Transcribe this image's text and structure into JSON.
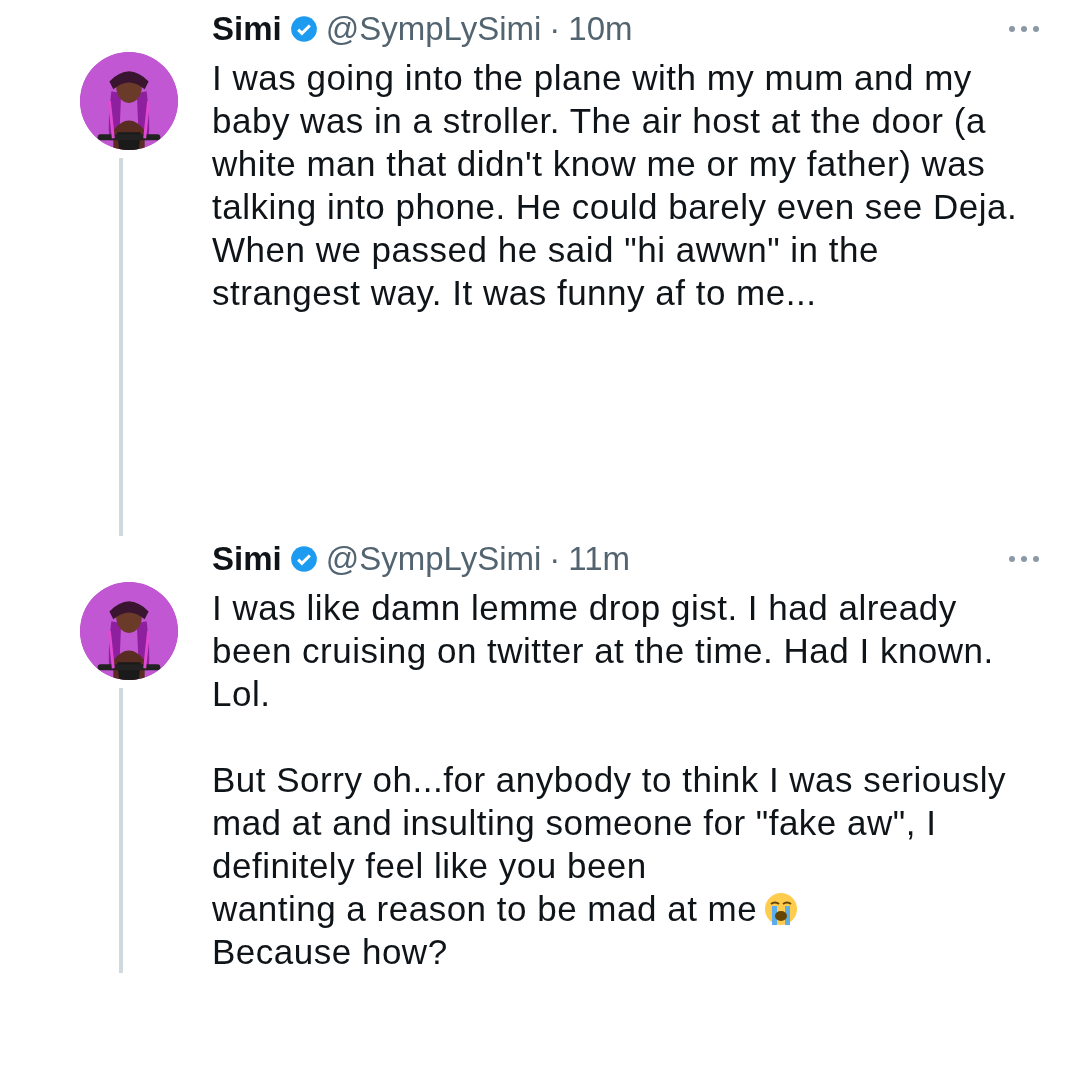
{
  "tweets": [
    {
      "name": "Simi",
      "verified": true,
      "handle": "@SympLySimi",
      "separator": "·",
      "time": "10m",
      "thread_line_below": true,
      "paragraphs": [
        [
          {
            "kind": "text",
            "text": "I was going into the plane with my mum and my baby was in a stroller. The air host at the door (a white man that didn't know me or my father) was talking into phone. He could barely even see Deja. When we passed he said \"hi awwn\" in the strangest way. It was funny af to me..."
          }
        ]
      ]
    },
    {
      "name": "Simi",
      "verified": true,
      "handle": "@SympLySimi",
      "separator": "·",
      "time": "11m",
      "thread_line_below": true,
      "paragraphs": [
        [
          {
            "kind": "text",
            "text": "I was like damn lemme drop gist. I had already been cruising on twitter at the time. Had I known. Lol."
          }
        ],
        [
          {
            "kind": "text",
            "text": "But Sorry oh...for anybody to think I was seriously mad at and insulting someone for \"fake aw\", I definitely feel like you been"
          },
          {
            "kind": "text",
            "text": "wanting a reason to be mad at me"
          },
          {
            "kind": "crying-emoji"
          },
          {
            "kind": "text",
            "text": "Because how?"
          }
        ]
      ]
    }
  ]
}
